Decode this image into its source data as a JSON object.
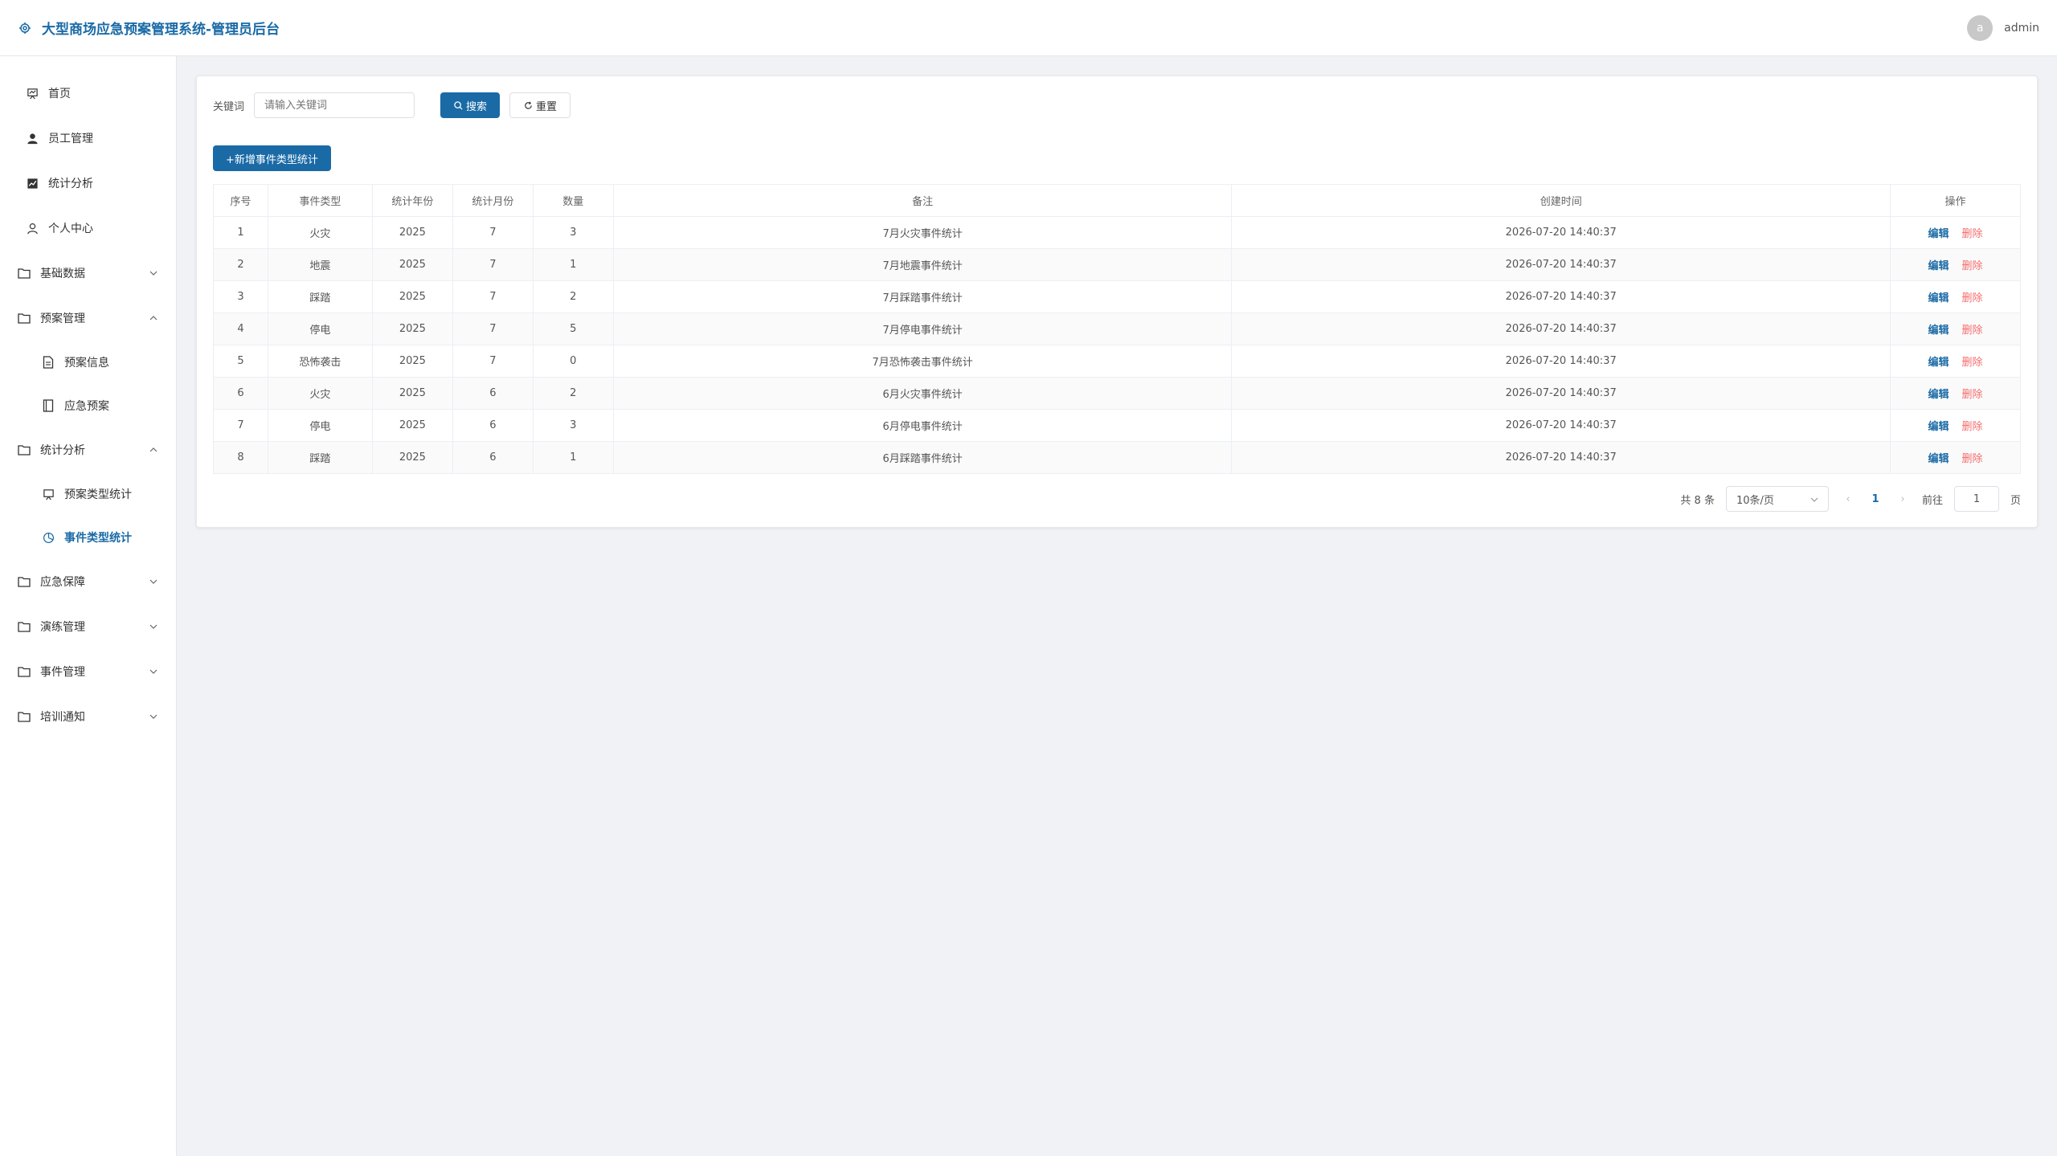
{
  "header": {
    "title": "大型商场应急预案管理系统-管理员后台",
    "avatar_letter": "a",
    "username": "admin"
  },
  "sidebar": {
    "items": [
      {
        "label": "首页",
        "icon": "home-icon",
        "kind": "item"
      },
      {
        "label": "员工管理",
        "icon": "user-icon",
        "kind": "item"
      },
      {
        "label": "统计分析",
        "icon": "chart-icon",
        "kind": "item"
      },
      {
        "label": "个人中心",
        "icon": "person-icon",
        "kind": "item"
      },
      {
        "label": "基础数据",
        "icon": "folder-icon",
        "kind": "folder",
        "expanded": false
      },
      {
        "label": "预案管理",
        "icon": "folder-icon",
        "kind": "folder",
        "expanded": true
      },
      {
        "label": "预案信息",
        "icon": "document-icon",
        "kind": "sub"
      },
      {
        "label": "应急预案",
        "icon": "book-icon",
        "kind": "sub"
      },
      {
        "label": "统计分析",
        "icon": "folder-icon",
        "kind": "folder",
        "expanded": true
      },
      {
        "label": "预案类型统计",
        "icon": "presentation-icon",
        "kind": "sub"
      },
      {
        "label": "事件类型统计",
        "icon": "pie-icon",
        "kind": "sub",
        "active": true
      },
      {
        "label": "应急保障",
        "icon": "folder-icon",
        "kind": "folder",
        "expanded": false
      },
      {
        "label": "演练管理",
        "icon": "folder-icon",
        "kind": "folder",
        "expanded": false
      },
      {
        "label": "事件管理",
        "icon": "folder-icon",
        "kind": "folder",
        "expanded": false
      },
      {
        "label": "培训通知",
        "icon": "folder-icon",
        "kind": "folder",
        "expanded": false
      }
    ]
  },
  "search": {
    "label": "关键词",
    "placeholder": "请输入关键词",
    "search_button": "搜索",
    "reset_button": "重置"
  },
  "add_button": "+新增事件类型统计",
  "table": {
    "columns": [
      "序号",
      "事件类型",
      "统计年份",
      "统计月份",
      "数量",
      "备注",
      "创建时间",
      "操作"
    ],
    "rows": [
      [
        "1",
        "火灾",
        "2025",
        "7",
        "3",
        "7月火灾事件统计",
        "2026-07-20 14:40:37"
      ],
      [
        "2",
        "地震",
        "2025",
        "7",
        "1",
        "7月地震事件统计",
        "2026-07-20 14:40:37"
      ],
      [
        "3",
        "踩踏",
        "2025",
        "7",
        "2",
        "7月踩踏事件统计",
        "2026-07-20 14:40:37"
      ],
      [
        "4",
        "停电",
        "2025",
        "7",
        "5",
        "7月停电事件统计",
        "2026-07-20 14:40:37"
      ],
      [
        "5",
        "恐怖袭击",
        "2025",
        "7",
        "0",
        "7月恐怖袭击事件统计",
        "2026-07-20 14:40:37"
      ],
      [
        "6",
        "火灾",
        "2025",
        "6",
        "2",
        "6月火灾事件统计",
        "2026-07-20 14:40:37"
      ],
      [
        "7",
        "停电",
        "2025",
        "6",
        "3",
        "6月停电事件统计",
        "2026-07-20 14:40:37"
      ],
      [
        "8",
        "踩踏",
        "2025",
        "6",
        "1",
        "6月踩踏事件统计",
        "2026-07-20 14:40:37"
      ]
    ],
    "edit_label": "编辑",
    "delete_label": "删除"
  },
  "pagination": {
    "total": "共 8 条",
    "page_size": "10条/页",
    "current_page": "1",
    "goto_label": "前往",
    "goto_value": "1",
    "page_suffix": "页"
  },
  "colors": {
    "accent": "#1a6aa6",
    "danger": "#f56c6c"
  }
}
